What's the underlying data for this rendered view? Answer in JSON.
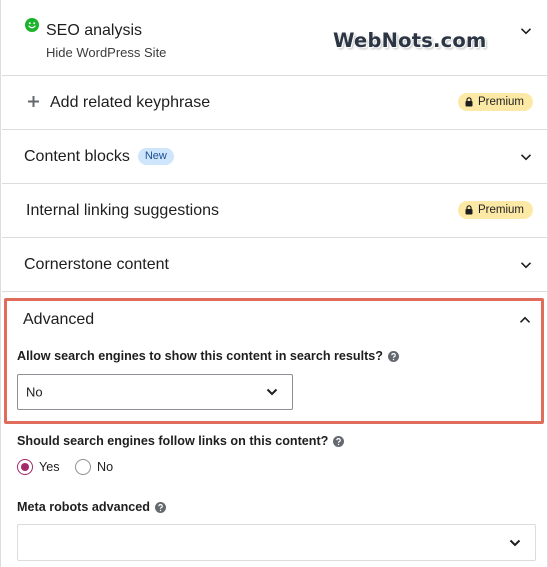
{
  "watermark": "WebNots.com",
  "seo_analysis": {
    "title": "SEO analysis",
    "subtitle": "Hide WordPress Site",
    "status_color": "#1bb32c"
  },
  "related_keyphrase": {
    "title": "Add related keyphrase",
    "badge": "Premium"
  },
  "content_blocks": {
    "title": "Content blocks",
    "badge": "New"
  },
  "internal_linking": {
    "title": "Internal linking suggestions",
    "badge": "Premium"
  },
  "cornerstone": {
    "title": "Cornerstone content"
  },
  "advanced": {
    "title": "Advanced",
    "allow_search": {
      "label": "Allow search engines to show this content in search results?",
      "value": "No"
    },
    "follow_links": {
      "label": "Should search engines follow links on this content?",
      "options": [
        "Yes",
        "No"
      ],
      "selected": "Yes"
    },
    "meta_robots": {
      "label": "Meta robots advanced",
      "value": ""
    }
  },
  "colors": {
    "premium_bg": "#fce9a5",
    "new_bg": "#cfe5fc",
    "highlight": "#e06d5c",
    "radio_accent": "#a4286a"
  },
  "icons": {
    "status": "smiley-icon",
    "expand": "chevron-down-icon",
    "collapse": "chevron-up-icon",
    "add": "plus-icon",
    "lock": "lock-icon",
    "help": "question-circle-icon"
  }
}
